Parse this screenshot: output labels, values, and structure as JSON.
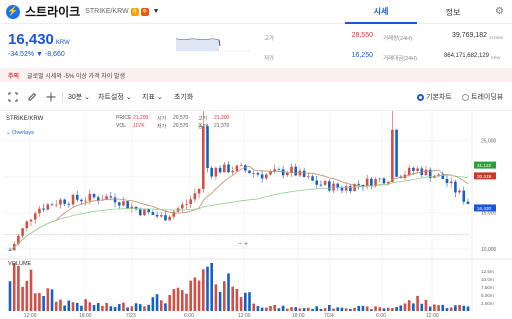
{
  "header": {
    "logo_glyph": "⚡",
    "coin_name": "스트라이크",
    "pair": "STRIKE/KRW",
    "badges": [
      {
        "text": "유",
        "color": "#f59f00"
      },
      {
        "text": "주",
        "color": "#e8590c"
      }
    ],
    "caret": "▼",
    "tabs": [
      {
        "label": "시세",
        "active": true
      },
      {
        "label": "정보",
        "active": false
      }
    ],
    "settings_icon": "gear-icon",
    "settings_glyph": "⚙"
  },
  "price": {
    "value": "16,430",
    "currency": "KRW",
    "change_pct": "-34.52%",
    "change_abs": "▼ -8,660"
  },
  "stats": {
    "high_label": "고가",
    "high": "28,550",
    "low_label": "저가",
    "low": "16,250",
    "vol_label": "거래량(24H)",
    "vol": "39,769,182",
    "vol_unit": "STRIKE",
    "amt_label": "거래대금(24H)",
    "amt": "864,171,682,129",
    "amt_unit": "KRW"
  },
  "notice": {
    "tag": "주의",
    "message": "글로벌 시세와 -5% 이상 가격 차이 발생"
  },
  "toolbar": {
    "interval": "30분 ⌄",
    "chart_settings": "차트설정 ⌄",
    "indicator": "지표 ⌄",
    "reset": "초기화",
    "basic_chart": "기본차트",
    "tradingview": "트레이딩뷰"
  },
  "chart": {
    "symbol": "STRIKE/KRW",
    "overlays": "⌄ Overlays",
    "ohlc": {
      "price_label": "PRICE",
      "price_val": "21,200",
      "vol_label": "VOL",
      "vol_val": "107K",
      "open_label": "시가",
      "open": "20,570",
      "high_label": "고가",
      "high": "21,200",
      "low_label": "저가",
      "low": "20,570",
      "close_label": "종가",
      "close": "21,200",
      "prev_close": "21,370"
    },
    "price_axis": [
      "25,000",
      "20,000",
      "15,000",
      "10,000"
    ],
    "price_tags": [
      {
        "text": "21,122",
        "color": "#2e9e3a"
      },
      {
        "text": "20,319",
        "color": "#c83a2c"
      },
      {
        "text": "16,430",
        "color": "#1a56db"
      }
    ],
    "volume_label": "VOLUME",
    "volume_axis": [
      "12.5m",
      "10.0m",
      "7.50m",
      "5.00m",
      "2.50m"
    ],
    "time_axis": [
      "12:00",
      "18:00",
      "7/23",
      "6:00",
      "12:00",
      "18:00",
      "7/24",
      "6:00",
      "12:00"
    ],
    "zoom_controls": "−  +"
  },
  "chart_data": {
    "type": "line",
    "title": "STRIKE/KRW",
    "xlabel": "",
    "ylabel": "",
    "x": [
      "7/22 09:00",
      "7/22 12:00",
      "7/22 15:00",
      "7/22 18:00",
      "7/22 21:00",
      "7/23 00:00",
      "7/23 03:00",
      "7/23 06:00",
      "7/23 09:00",
      "7/23 12:00",
      "7/23 15:00",
      "7/23 18:00",
      "7/23 21:00",
      "7/24 00:00",
      "7/24 03:00",
      "7/24 06:00",
      "7/24 09:00",
      "7/24 12:00",
      "7/24 15:00"
    ],
    "series": [
      {
        "name": "",
        "values": [
          9800,
          15500,
          16700,
          17000,
          17200,
          15400,
          14300,
          16400,
          21000,
          21100,
          20200,
          20900,
          19100,
          18400,
          19200,
          20000,
          21000,
          19800,
          16430
        ]
      }
    ],
    "volume": [
      12.5,
      8.0,
      3.0,
      2.5,
      1.5,
      2.5,
      4.0,
      6.0,
      13.0,
      7.0,
      1.5,
      1.0,
      1.0,
      1.5,
      1.0,
      1.0,
      3.5,
      1.5,
      1.5
    ],
    "ylim": [
      9000,
      28000
    ],
    "volume_ylim": [
      0,
      15
    ]
  }
}
